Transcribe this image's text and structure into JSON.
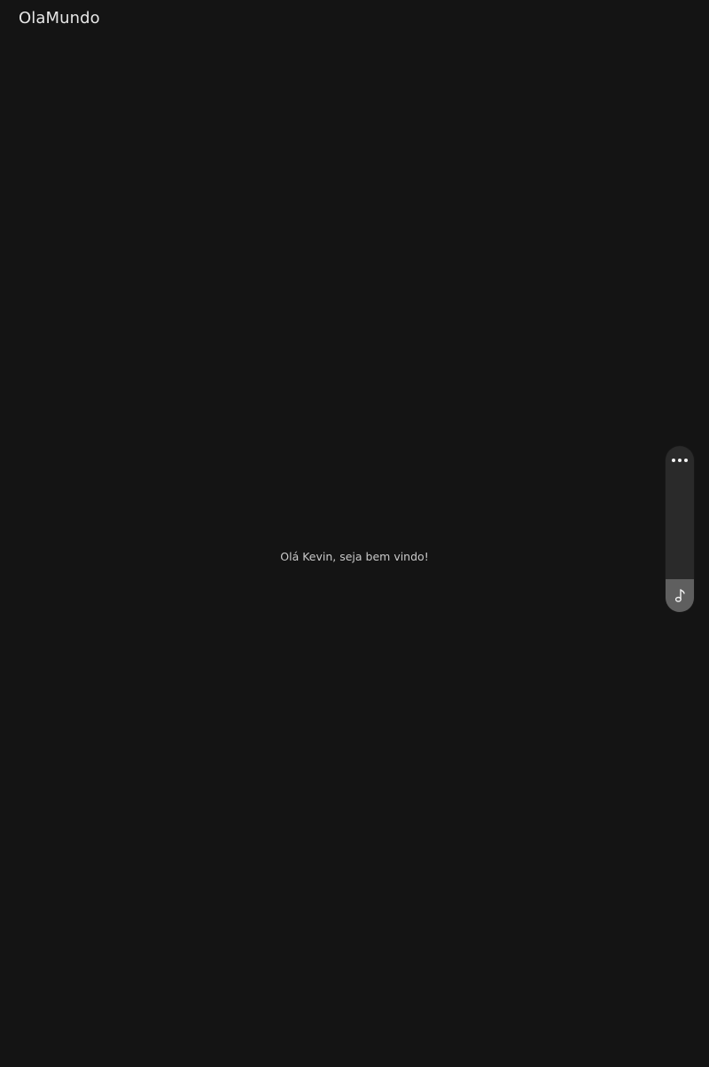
{
  "app": {
    "title": "OlaMundo"
  },
  "main": {
    "welcome_text": "Olá Kevin, seja bem vindo!"
  },
  "side_panel": {
    "more_icon": "more-horizontal-icon",
    "music_icon": "music-note-icon"
  },
  "colors": {
    "background": "#141414",
    "panel": "#2a2a2a",
    "panel_button": "#5f5f5f",
    "text": "#e6e6e6"
  }
}
